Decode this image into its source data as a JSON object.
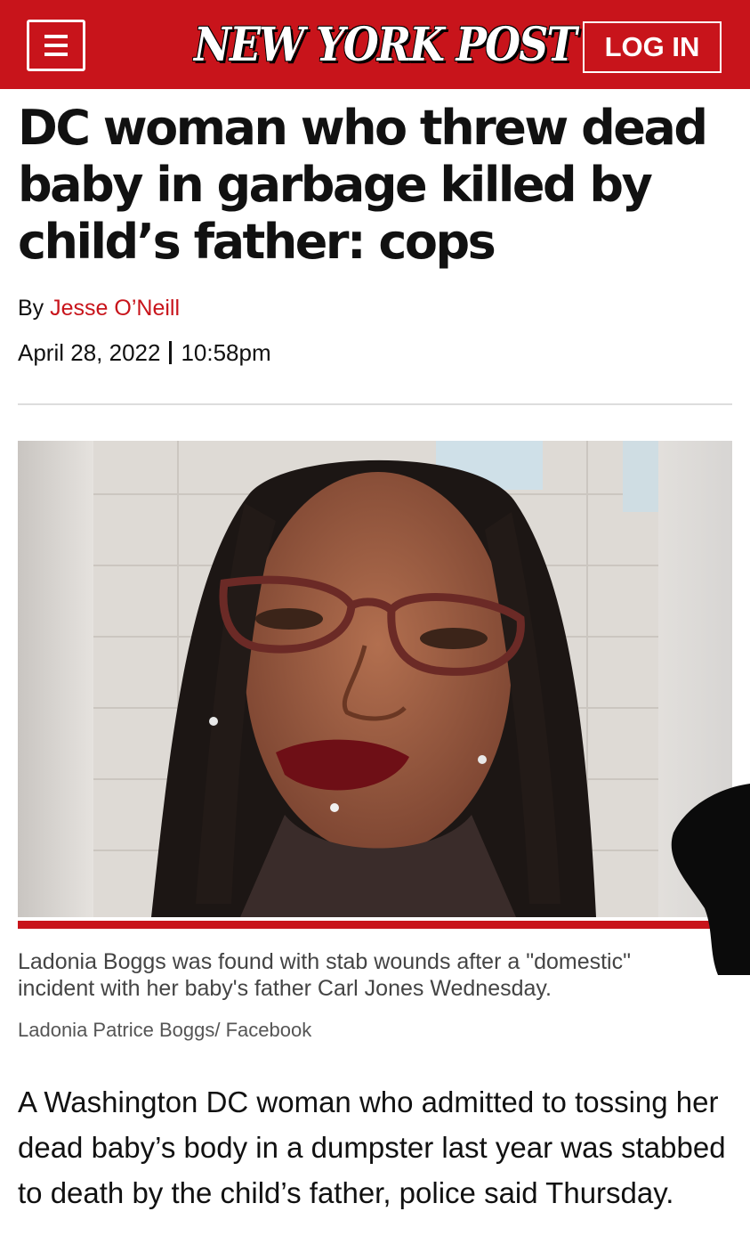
{
  "header": {
    "brand": "NEW YORK POST",
    "login_label": "LOG IN",
    "brand_color": "#c8141b"
  },
  "article": {
    "headline": "DC woman who threw dead baby in garbage killed by child’s father: cops",
    "by_prefix": "By",
    "author": "Jesse O’Neill",
    "date": "April 28, 2022",
    "time": "10:58pm",
    "image": {
      "caption": "Ladonia Boggs was found with stab wounds after a \"domestic\" incident with her baby's father Carl Jones Wednesday.",
      "credit": "Ladonia Patrice Boggs/ Facebook"
    },
    "lead_paragraph": "A Washington DC woman who admitted to tossing her dead baby’s body in a dumpster last year was stabbed to death by the child’s father, police said Thursday."
  },
  "icons": {
    "menu": "hamburger-menu-icon"
  }
}
